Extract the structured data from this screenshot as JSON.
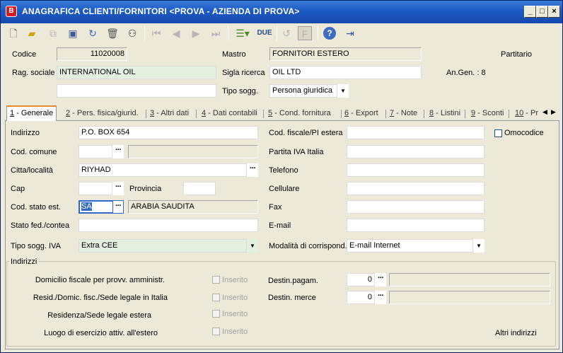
{
  "window": {
    "title": "ANAGRAFICA CLIENTI/FORNITORI <PROVA - AZIENDA DI PROVA>",
    "app_icon": "B",
    "controls": {
      "minimize": "_",
      "maximize": "□",
      "close": "×"
    }
  },
  "toolbar": {
    "icons": [
      "new-icon",
      "open-icon",
      "copy-icon",
      "save-icon",
      "undo-icon",
      "delete-icon",
      "search-binoculars-icon",
      "first-icon",
      "prev-icon",
      "next-icon",
      "last-icon",
      "list-menu-icon",
      "due-icon",
      "refresh-icon",
      "filter-icon",
      "help-icon",
      "exit-icon"
    ],
    "due_label": "DUE"
  },
  "header": {
    "codice_label": "Codice",
    "codice_value": "11020008",
    "mastro_label": "Mastro",
    "mastro_value": "FORNITORI ESTERO",
    "partitario_label": "Partitario",
    "rag_sociale_label": "Rag. sociale",
    "rag_sociale_value": "INTERNATIONAL OIL",
    "rag_sociale_2_value": "",
    "sigla_label": "Sigla ricerca",
    "sigla_value": "OIL LTD",
    "angen_label": "An.Gen. : 8",
    "tipo_sogg_label": "Tipo sogg.",
    "tipo_sogg_value": "Persona giuridica"
  },
  "tabs": [
    {
      "key": "1",
      "label": " - Generale"
    },
    {
      "key": "2",
      "label": " - Pers. fisica/giurid."
    },
    {
      "key": "3",
      "label": " - Altri dati"
    },
    {
      "key": "4",
      "label": " - Dati contabili"
    },
    {
      "key": "5",
      "label": " - Cond. fornitura"
    },
    {
      "key": "6",
      "label": " - Export"
    },
    {
      "key": "7",
      "label": " - Note"
    },
    {
      "key": "8",
      "label": " - Listini"
    },
    {
      "key": "9",
      "label": " - Sconti"
    },
    {
      "key": "10",
      "label": " - Pr"
    }
  ],
  "generale": {
    "indirizzo_label": "Indirizzo",
    "indirizzo_value": "P.O. BOX 654",
    "cod_comune_label": "Cod. comune",
    "cod_comune_value": "",
    "comune_desc": "",
    "citta_label": "Citta/località",
    "citta_value": "RIYHAD",
    "cap_label": "Cap",
    "cap_value": "",
    "provincia_label": "Provincia",
    "provincia_value": "",
    "cod_stato_label": "Cod. stato est.",
    "cod_stato_value": "SA",
    "stato_desc": "ARABIA SAUDITA",
    "stato_fed_label": "Stato fed./contea",
    "stato_fed_value": "",
    "tipo_iva_label": "Tipo sogg. IVA",
    "tipo_iva_value": "Extra CEE",
    "cod_fiscale_label": "Cod. fiscale/PI estera",
    "cod_fiscale_value": "",
    "omocodice_label": "Omocodice",
    "partita_iva_label": "Partita IVA Italia",
    "partita_iva_value": "",
    "telefono_label": "Telefono",
    "telefono_value": "",
    "cellulare_label": "Cellulare",
    "cellulare_value": "",
    "fax_label": "Fax",
    "fax_value": "",
    "email_label": "E-mail",
    "email_value": "",
    "modalita_label": "Modalità di corrispond.",
    "modalita_value": "E-mail Internet"
  },
  "indirizzi": {
    "title": "Indirizzi",
    "rows": [
      {
        "label": "Domicilio fiscale per provv. amministr.",
        "inserito": "Inserito"
      },
      {
        "label": "Resid./Domic. fisc./Sede legale in Italia",
        "inserito": "Inserito"
      },
      {
        "label": "Residenza/Sede legale estera",
        "inserito": "Inserito"
      },
      {
        "label": "Luogo di esercizio attiv. all'estero",
        "inserito": "Inserito"
      }
    ],
    "destin_pagam_label": "Destin.pagam.",
    "destin_pagam_value": "0",
    "destin_merce_label": "Destin. merce",
    "destin_merce_value": "0",
    "altri_label": "Altri indirizzi"
  }
}
